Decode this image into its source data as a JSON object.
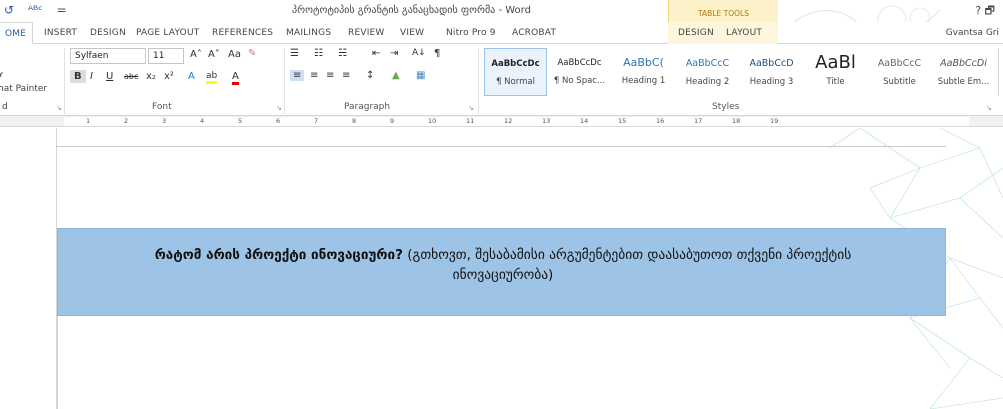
{
  "title_bar": {
    "quick_access": [
      "↺",
      "ᴬᴮᶜ",
      "="
    ],
    "document_title": "პროტოტიპის გრანტის განაცხადის ფორმა - Word",
    "context_tab_group": "TABLE TOOLS",
    "window_controls": "? 🗗"
  },
  "tabs": [
    {
      "label": "OME",
      "active": true
    },
    {
      "label": "INSERT"
    },
    {
      "label": "DESIGN"
    },
    {
      "label": "PAGE LAYOUT"
    },
    {
      "label": "REFERENCES"
    },
    {
      "label": "MAILINGS"
    },
    {
      "label": "REVIEW"
    },
    {
      "label": "VIEW"
    },
    {
      "label": "Nitro Pro 9"
    },
    {
      "label": "ACROBAT"
    },
    {
      "label": "DESIGN"
    },
    {
      "label": "LAYOUT"
    }
  ],
  "user": "Gvantsa Gri",
  "clipboard": {
    "format_painter": "hat Painter",
    "paste_letter": "d"
  },
  "font": {
    "family": "Sylfaen",
    "size": "11",
    "grow": "A˄",
    "shrink": "A˅",
    "case": "Aa",
    "clear": "✎",
    "bold": "B",
    "italic": "I",
    "underline": "U",
    "strike": "abc",
    "subscript": "x₂",
    "superscript": "x²",
    "effects": "A",
    "highlight": "ab",
    "color": "A",
    "group_label": "Font"
  },
  "paragraph": {
    "bullets": "☰",
    "numbering": "☷",
    "multilevel": "☵",
    "decrease_indent": "⇤",
    "increase_indent": "⇥",
    "sort": "A↓",
    "pilcrow": "¶",
    "align_left": "≡",
    "align_center": "≡",
    "align_right": "≡",
    "justify": "≡",
    "line_spacing": "↕",
    "shading": "▲",
    "borders": "▦",
    "group_label": "Paragraph"
  },
  "styles": {
    "group_label": "Styles",
    "items": [
      {
        "preview": "AaBbCcDc",
        "name": "¶ Normal",
        "selected": true
      },
      {
        "preview": "AaBbCcDc",
        "name": "¶ No Spac..."
      },
      {
        "preview": "AaBbC(",
        "name": "Heading 1"
      },
      {
        "preview": "AaBbCcC",
        "name": "Heading 2"
      },
      {
        "preview": "AaBbCcD",
        "name": "Heading 3"
      },
      {
        "preview": "AaBl",
        "name": "Title"
      },
      {
        "preview": "AaBbCcC",
        "name": "Subtitle"
      },
      {
        "preview": "AaBbCcDi",
        "name": "Subtle Em..."
      }
    ]
  },
  "ruler": {
    "numbers": [
      "1",
      "2",
      "3",
      "4",
      "5",
      "6",
      "7",
      "8",
      "9",
      "10",
      "11",
      "12",
      "13",
      "14",
      "15",
      "16",
      "17",
      "18",
      "19"
    ]
  },
  "document": {
    "question_bold": "რატომ არის პროექტი ინოვაციური?",
    "question_rest": " (გთხოვთ, შესაბამისი არგუმენტებით დაასაბუთოთ თქვენი პროექტის ინოვაციურობა)"
  },
  "colors": {
    "accent": "#2b579a",
    "cell_fill": "#9dc3e6",
    "table_tools": "#fdf1c9"
  }
}
